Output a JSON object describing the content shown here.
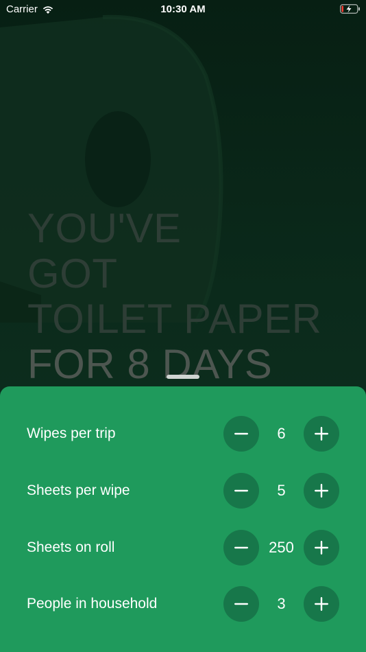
{
  "status_bar": {
    "carrier": "Carrier",
    "time": "10:30 AM",
    "icons": [
      "wifi-icon",
      "battery-charging-icon"
    ]
  },
  "headline": {
    "line1": "YOU'VE",
    "line2": "GOT",
    "line3": "TOILET PAPER",
    "line4": "FOR 8 DAYS"
  },
  "colors": {
    "background": "#082717",
    "sheet": "#1f9a5c",
    "stepper_button": "#17774a"
  },
  "settings": [
    {
      "label": "Wipes per trip",
      "value": "6"
    },
    {
      "label": "Sheets per wipe",
      "value": "5"
    },
    {
      "label": "Sheets on roll",
      "value": "250"
    },
    {
      "label": "People in household",
      "value": "3"
    }
  ],
  "stepper_icons": {
    "decrement": "minus-icon",
    "increment": "plus-icon"
  }
}
